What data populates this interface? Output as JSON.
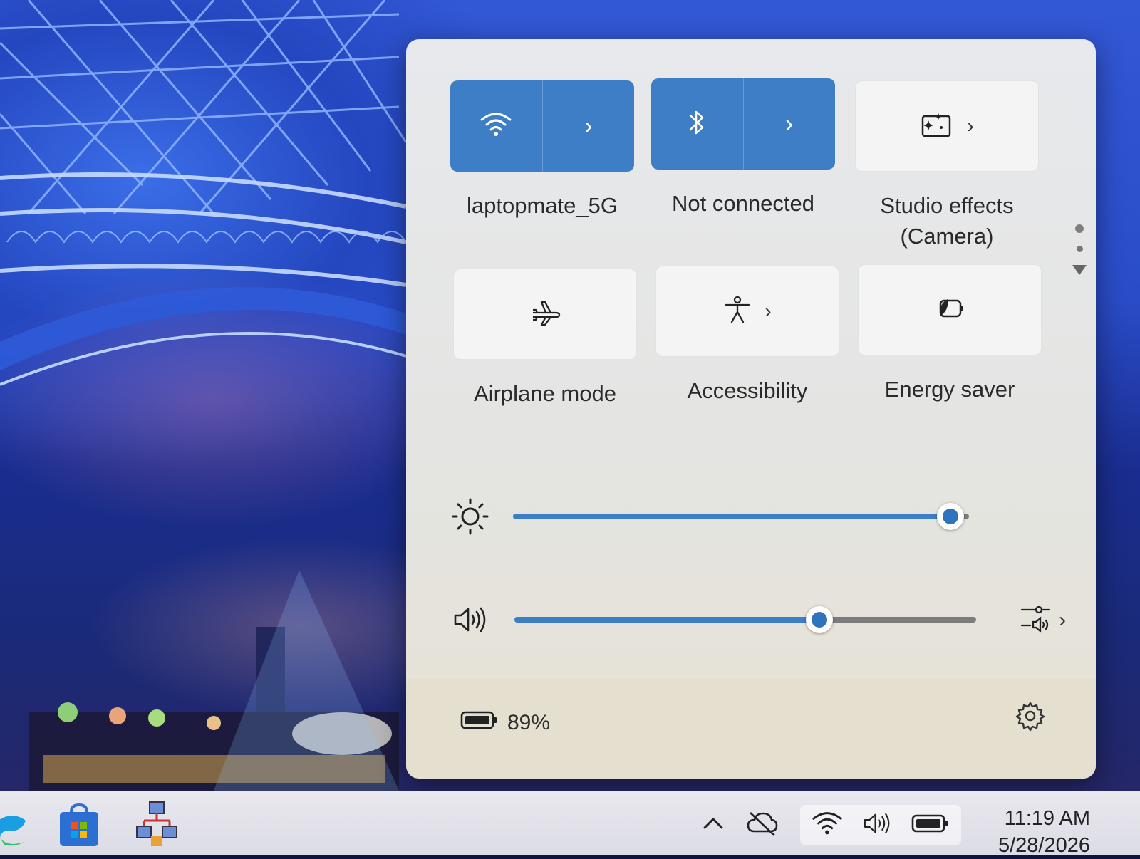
{
  "quick_settings": {
    "tiles": [
      {
        "id": "wifi",
        "label": "laptopmate_5G",
        "state": "on",
        "icon": "wifi-icon",
        "has_chevron": true
      },
      {
        "id": "bluetooth",
        "label": "Not connected",
        "state": "on",
        "icon": "bluetooth-icon",
        "has_chevron": true
      },
      {
        "id": "studio-effects",
        "label": "Studio effects (Camera)",
        "state": "off",
        "icon": "studio-effects-icon",
        "has_chevron": true
      },
      {
        "id": "airplane",
        "label": "Airplane mode",
        "state": "off",
        "icon": "airplane-icon",
        "has_chevron": false
      },
      {
        "id": "accessibility",
        "label": "Accessibility",
        "state": "off",
        "icon": "accessibility-icon",
        "has_chevron": true
      },
      {
        "id": "energy-saver",
        "label": "Energy saver",
        "state": "off",
        "icon": "energy-saver-icon",
        "has_chevron": false
      }
    ],
    "pager": {
      "pages": 2,
      "current": 1
    },
    "brightness": {
      "icon": "brightness-icon",
      "level": 0.96
    },
    "volume": {
      "icon": "speaker-icon",
      "level": 0.66,
      "output_icon": "audio-output-icon"
    },
    "battery": {
      "icon": "battery-icon",
      "percent_text": "89%"
    },
    "settings_icon": "gear-icon"
  },
  "taskbar": {
    "apps": [
      "edge-icon",
      "store-icon",
      "network-app-icon"
    ],
    "tray_icons": [
      "chevron-up-icon",
      "cloud-offline-icon",
      "wifi-icon",
      "speaker-icon",
      "battery-icon"
    ],
    "clock": {
      "time": "11:19 AM",
      "date": "5/28/2026"
    }
  },
  "colors": {
    "accent": "#3d7ec6",
    "panel": "#e6e6e4",
    "track": "#7c7c7c"
  }
}
